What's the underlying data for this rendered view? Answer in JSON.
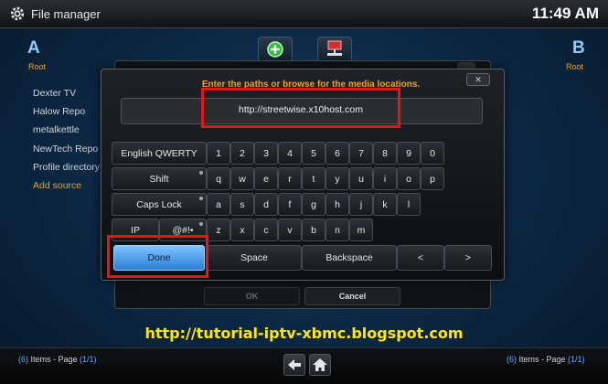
{
  "topbar": {
    "title": "File manager",
    "clock": "11:49 AM"
  },
  "left_pane": {
    "letter": "A",
    "root": "Root",
    "items": [
      "Dexter TV",
      "Halow Repo",
      "metalkettle",
      "NewTech Repo",
      "Profile directory",
      "Add source"
    ]
  },
  "right_pane": {
    "letter": "B",
    "root": "Root"
  },
  "dialog": {
    "heading": "Enter the paths or browse for the media locations.",
    "url_value": "http://streetwise.x10host.com",
    "ok_label": "OK",
    "cancel_label": "Cancel"
  },
  "keyboard": {
    "layout_label": "English QWERTY",
    "shift_label": "Shift",
    "caps_label": "Caps Lock",
    "ip_label": "IP",
    "symbols_label": "@#!•",
    "row1": [
      "1",
      "2",
      "3",
      "4",
      "5",
      "6",
      "7",
      "8",
      "9",
      "0"
    ],
    "row2": [
      "q",
      "w",
      "e",
      "r",
      "t",
      "y",
      "u",
      "i",
      "o",
      "p"
    ],
    "row3": [
      "a",
      "s",
      "d",
      "f",
      "g",
      "h",
      "j",
      "k",
      "l"
    ],
    "row4": [
      "z",
      "x",
      "c",
      "v",
      "b",
      "n",
      "m"
    ],
    "done_label": "Done",
    "space_label": "Space",
    "backspace_label": "Backspace",
    "left_label": "<",
    "right_label": ">"
  },
  "watermark": "http://tutorial-iptv-xbmc.blogspot.com",
  "bottom": {
    "left_items": "(6)",
    "left_items_word": " Items - Page ",
    "left_page": "(1/1)",
    "right_items": "(6)",
    "right_items_word": " Items - Page ",
    "right_page": "(1/1)"
  },
  "colors": {
    "accent": "#f0a020",
    "highlight": "#e8141a",
    "watermark": "#ffe812",
    "done_key": "#4aa3f0"
  },
  "icons": [
    "gear-icon",
    "add-source-icon",
    "network-icon",
    "back-arrow-icon",
    "home-icon"
  ]
}
